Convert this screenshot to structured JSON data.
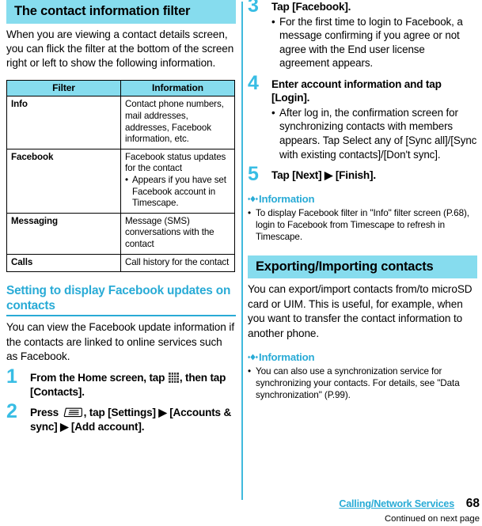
{
  "page": {
    "number": "68",
    "chapter_link": "Calling/Network Services",
    "continued_note": "Continued on next page"
  },
  "colors": {
    "banner_bg": "#86dcee",
    "accent": "#29ABD6",
    "step_number": "#38BDE4"
  },
  "left_column": {
    "banner_title": "The contact information filter",
    "intro_paragraph": "When you are viewing a contact details screen, you can flick the filter at the bottom of the screen right or left to show the following information.",
    "table": {
      "headers": [
        "Filter",
        "Information"
      ],
      "rows": [
        {
          "filter": "Info",
          "description": "Contact phone numbers, mail addresses, addresses, Facebook information, etc.",
          "bullets": []
        },
        {
          "filter": "Facebook",
          "description": "Facebook status updates for the contact",
          "bullets": [
            "Appears if you have set Facebook account in Timescape."
          ]
        },
        {
          "filter": "Messaging",
          "description": "Message (SMS) conversations with the contact",
          "bullets": []
        },
        {
          "filter": "Calls",
          "description": "Call history for the contact",
          "bullets": []
        }
      ]
    },
    "section_heading": "Setting to display Facebook updates on contacts",
    "section_paragraph": "You can view the Facebook update information if the contacts are linked to online services such as Facebook.",
    "steps": [
      {
        "number": "1",
        "title_before_icon": "From the Home screen, tap ",
        "icon": "app-drawer-grid-icon",
        "title_after_icon": ", then tap [Contacts].",
        "subs": []
      },
      {
        "number": "2",
        "title_before_icon": "Press ",
        "icon": "menu-key-icon",
        "title_after_icon": ", tap [Settings] ▶ [Accounts & sync] ▶ [Add account].",
        "subs": []
      }
    ]
  },
  "right_column": {
    "steps": [
      {
        "number": "3",
        "title": "Tap [Facebook].",
        "subs": [
          "For the first time to login to Facebook, a message confirming if you agree or not agree with the End user license agreement appears."
        ]
      },
      {
        "number": "4",
        "title": "Enter account information and tap [Login].",
        "subs": [
          "After log in, the confirmation screen for synchronizing contacts with members appears. Tap Select any of [Sync all]/[Sync with existing contacts]/[Don't sync]."
        ]
      },
      {
        "number": "5",
        "title": "Tap [Next] ▶ [Finish].",
        "subs": []
      }
    ],
    "information_1": {
      "heading": "Information",
      "items": [
        "To display Facebook filter in \"Info\" filter screen (P.68), login to Facebook from Timescape to refresh in Timescape."
      ]
    },
    "banner_title": "Exporting/Importing contacts",
    "paragraph": "You can export/import contacts from/to microSD card or UIM. This is useful, for example, when you want to transfer the contact information to another phone.",
    "information_2": {
      "heading": "Information",
      "items": [
        "You can also use a synchronization service for synchronizing your contacts. For details, see \"Data synchronization\" (P.99)."
      ]
    }
  }
}
